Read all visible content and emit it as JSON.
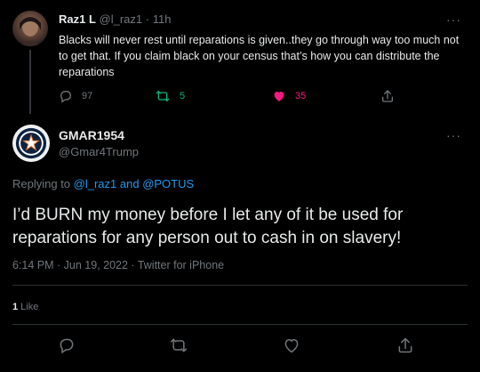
{
  "parent_tweet": {
    "author_name": "Raz1 L",
    "author_handle": "@l_raz1",
    "separator": "·",
    "time": "11h",
    "text": "Blacks will never rest until reparations  is given..they go through way too much not to get that. If you claim black on your census that’s how you can distribute the reparations",
    "replies": "97",
    "retweets": "5",
    "likes": "35",
    "colors": {
      "retweet": "#00ba7c",
      "like": "#f91880"
    },
    "icons": [
      "reply-icon",
      "retweet-icon",
      "heart-filled-icon",
      "share-icon",
      "more-icon"
    ]
  },
  "main_tweet": {
    "author_name": "GMAR1954",
    "author_handle": "@Gmar4Trump",
    "replying_prefix": "Replying to ",
    "replying_user1": "@l_raz1",
    "replying_and": " and ",
    "replying_user2": "@POTUS",
    "text": "I’d BURN my money before I let any of it be used for reparations for any person out to cash in on slavery!",
    "meta": "6:14 PM · Jun 19, 2022 · Twitter for iPhone",
    "like_count": "1",
    "like_label": " Like",
    "icons": [
      "astros-logo-avatar",
      "reply-icon",
      "retweet-icon",
      "heart-outline-icon",
      "share-icon",
      "more-icon"
    ]
  },
  "more_glyph": "···",
  "colors": {
    "link": "#1d9bf0",
    "muted": "#71767b",
    "text": "#e7e9ea",
    "background": "#000000"
  }
}
